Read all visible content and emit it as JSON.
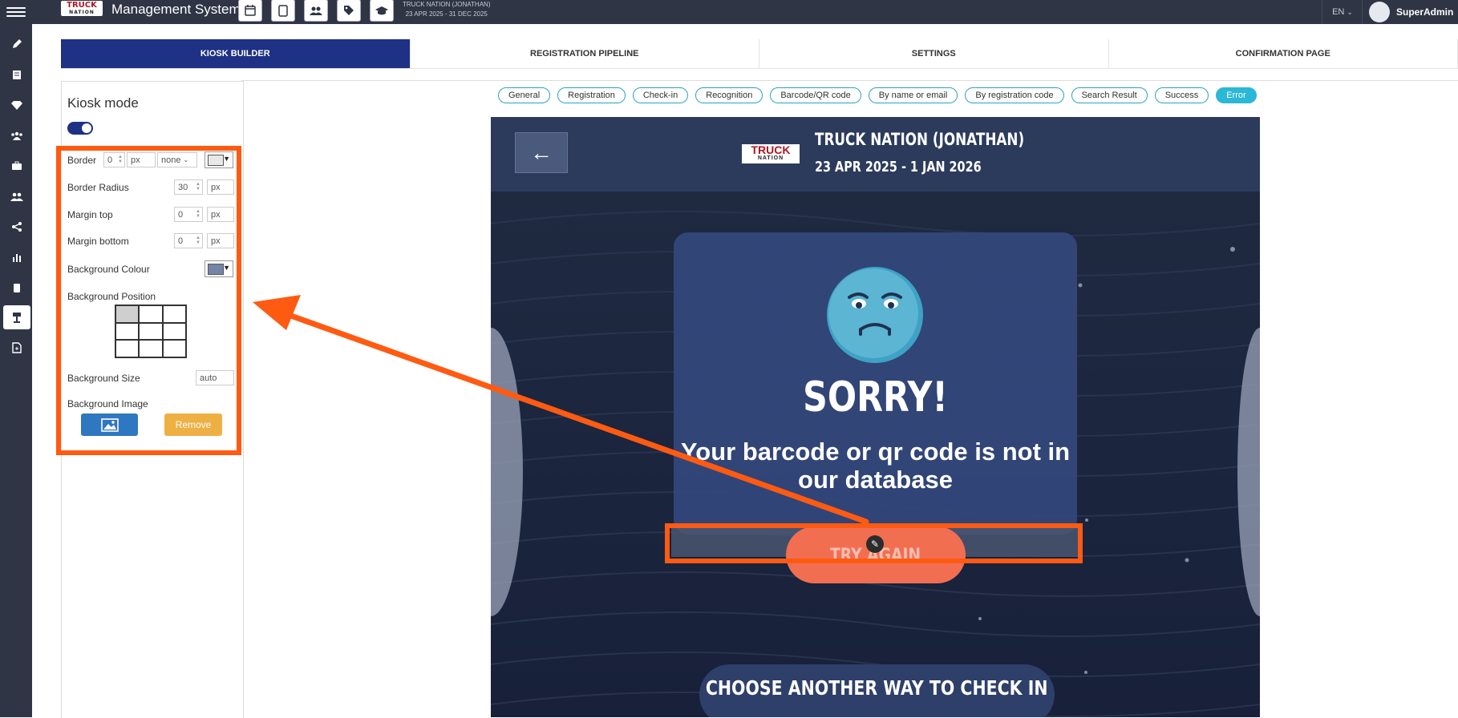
{
  "topbar": {
    "title": "Management System",
    "logo_text": "TRUCK",
    "logo_sub": "NATION",
    "event_name": "TRUCK NATION (JONATHAN)",
    "event_dates": "23 APR 2025 - 31 DEC 2025",
    "language": "EN",
    "user_name": "SuperAdmin",
    "icons": [
      "calendar-icon",
      "tablet-icon",
      "users-icon",
      "tag-icon",
      "graduation-cap-icon"
    ]
  },
  "sidebar": {
    "items": [
      "pencil-icon",
      "form-icon",
      "diamond-icon",
      "group-icon",
      "briefcase-icon",
      "people-icon",
      "share-icon",
      "bar-chart-icon",
      "tablet-icon",
      "kiosk-stand-icon",
      "document-icon"
    ]
  },
  "tabs": [
    {
      "label": "KIOSK BUILDER",
      "active": true
    },
    {
      "label": "REGISTRATION PIPELINE",
      "active": false
    },
    {
      "label": "SETTINGS",
      "active": false
    },
    {
      "label": "CONFIRMATION PAGE",
      "active": false
    }
  ],
  "panel": {
    "kiosk_mode_label": "Kiosk mode",
    "kiosk_mode_on": true,
    "border_label": "Border",
    "border_value": "0",
    "border_unit": "px",
    "border_style": "none",
    "border_radius_label": "Border Radius",
    "border_radius_value": "30",
    "border_radius_unit": "px",
    "margin_top_label": "Margin top",
    "margin_top_value": "0",
    "margin_top_unit": "px",
    "margin_bottom_label": "Margin bottom",
    "margin_bottom_value": "0",
    "margin_bottom_unit": "px",
    "bg_colour_label": "Background Colour",
    "bg_position_label": "Background Position",
    "bg_size_label": "Background Size",
    "bg_size_value": "auto",
    "bg_image_label": "Background Image",
    "remove_label": "Remove"
  },
  "pills": [
    {
      "label": "General",
      "active": false
    },
    {
      "label": "Registration",
      "active": false
    },
    {
      "label": "Check-in",
      "active": false
    },
    {
      "label": "Recognition",
      "active": false
    },
    {
      "label": "Barcode/QR code",
      "active": false
    },
    {
      "label": "By name or email",
      "active": false
    },
    {
      "label": "By registration code",
      "active": false
    },
    {
      "label": "Search Result",
      "active": false
    },
    {
      "label": "Success",
      "active": false
    },
    {
      "label": "Error",
      "active": true
    }
  ],
  "preview": {
    "back_arrow": "←",
    "logo_text": "TRUCK",
    "logo_sub": "NATION",
    "event_title": "TRUCK NATION (JONATHAN)",
    "event_dates": "23 APR 2025 - 1 JAN 2026",
    "heading": "SORRY!",
    "message": "Your barcode or qr code is not in our database",
    "try_again_label": "TRY AGAIN",
    "choose_label": "CHOOSE ANOTHER WAY TO CHECK IN"
  },
  "colors": {
    "accent": "#1e3185",
    "annotation": "#ff5a12",
    "try_again": "#f26e50",
    "pill_active": "#2ab8d6"
  }
}
